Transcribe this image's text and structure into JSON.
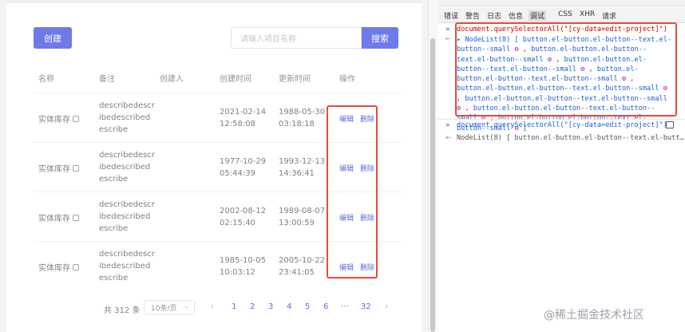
{
  "toolbar": {
    "create_label": "创建",
    "search_placeholder": "请输入项目名称",
    "search_label": "搜索"
  },
  "table": {
    "headers": [
      "名称",
      "备注",
      "创建人",
      "创建时间",
      "更新时间",
      "操作"
    ],
    "rows": [
      {
        "name": "实体库存",
        "desc": "describedescribedescribedescribe",
        "creator": "",
        "created": "2021-02-14 12:58:08",
        "updated": "1988-05-30 03:18:18",
        "edit": "编辑",
        "delete": "删除"
      },
      {
        "name": "实体库存",
        "desc": "describedescribedescribedescribe",
        "creator": "",
        "created": "1977-10-29 05:44:39",
        "updated": "1993-12-13 14:36:41",
        "edit": "编辑",
        "delete": "删除"
      },
      {
        "name": "实体库存",
        "desc": "describedescribedescribedescribe",
        "creator": "",
        "created": "2002-08-12 02:15:40",
        "updated": "1989-08-07 13:00:59",
        "edit": "编辑",
        "delete": "删除"
      },
      {
        "name": "实体库存",
        "desc": "describedescribedescribedescribe",
        "creator": "",
        "created": "1985-10-05 10:03:12",
        "updated": "2005-10-22 23:41:05",
        "edit": "编辑",
        "delete": "删除"
      }
    ]
  },
  "pagination": {
    "total": "共 312 条",
    "page_size": "10条/页",
    "pages": [
      "1",
      "2",
      "3",
      "4",
      "5",
      "6",
      "···",
      "32"
    ],
    "prev": "‹",
    "next": "›"
  },
  "devtools": {
    "tabs": [
      "错误",
      "警告",
      "日志",
      "信息",
      "调试",
      "CSS",
      "XHR",
      "请求"
    ],
    "active_tab": "调试",
    "command1": "document.querySelectorAll(\"[cy-data=edit-project]\")",
    "result1_prefix": "▸ NodeList(8) [",
    "result1_item": "button.el-button.el-button--text.el-button--small",
    "result1_suffix": "]",
    "command2": "document.querySelectorAll(\"[cy-data=edit-project]\")",
    "result2": "NodeList(8) [ button.el-button.el-button--text.el-butt…"
  },
  "watermark": "@稀土掘金技术社区",
  "colors": {
    "primary": "#6f79e8",
    "link": "#5b6ce1",
    "highlight": "#e84a3a",
    "console_red": "#c80000",
    "console_purple": "#b40f9c"
  }
}
